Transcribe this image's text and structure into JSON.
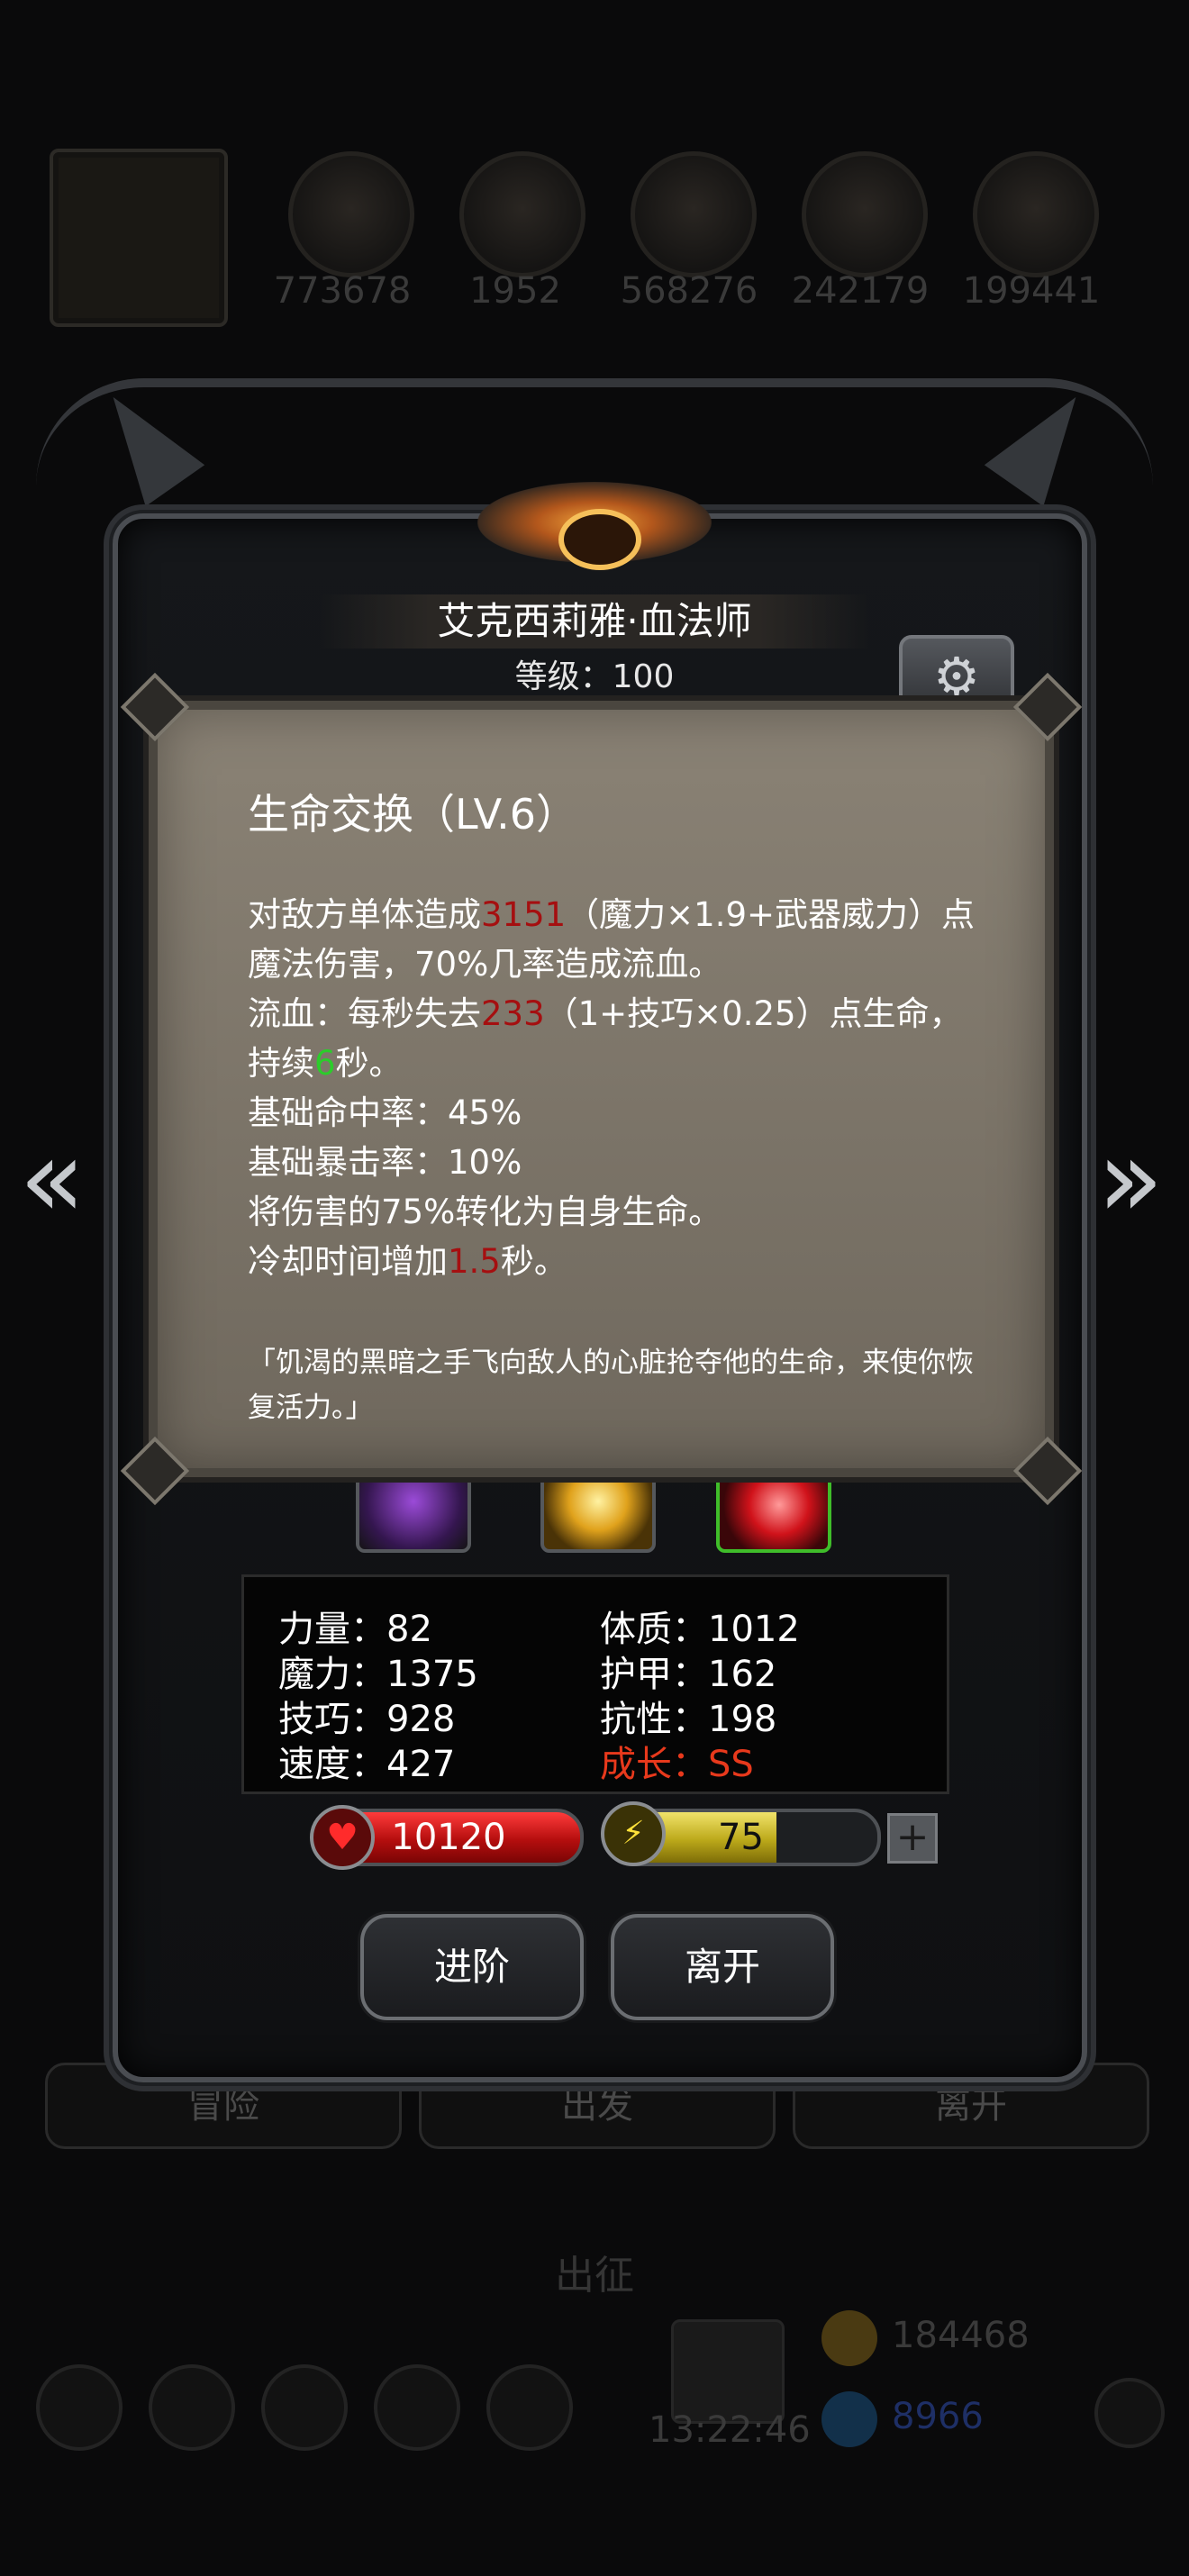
{
  "background": {
    "resources": [
      "773678",
      "1952",
      "568276",
      "242179",
      "199441"
    ],
    "tabs": [
      "冒险",
      "出发",
      "离开"
    ],
    "title": "出征",
    "time": "13:22:46",
    "gold": "184468",
    "gems": "8966"
  },
  "hero": {
    "name": "艾克西莉雅·血法师",
    "level": "等级：100"
  },
  "skill_tooltip": {
    "title": "生命交换（LV.6）",
    "desc": {
      "l1a": "对敌方单体造成",
      "l1_dmg": "3151",
      "l1b": "（魔力×1.9+武器威力）点魔法伤害，70%几率造成流血。",
      "l2a": "流血：每秒失去",
      "l2_val": "233",
      "l2b": "（1+技巧×0.25）点生命，持续",
      "l2_dur": "6",
      "l2c": "秒。",
      "l3": "基础命中率：45%",
      "l4": "基础暴击率：10%",
      "l5": "将伤害的75%转化为自身生命。",
      "l6a": "冷却时间增加",
      "l6_val": "1.5",
      "l6b": "秒。"
    },
    "flavor": "「饥渴的黑暗之手飞向敌人的心脏抢夺他的生命，来使你恢复活力。」"
  },
  "stats": {
    "strength": "力量：82",
    "constitution": "体质：1012",
    "magic": "魔力：1375",
    "armor": "护甲：162",
    "skill": "技巧：928",
    "resistance": "抗性：198",
    "speed": "速度：427",
    "growth": "成长：SS"
  },
  "bars": {
    "hp": "10120",
    "energy": "75",
    "energy_fill": 0.62
  },
  "buttons": {
    "advance": "进阶",
    "leave": "离开"
  },
  "colors": {
    "highlight_red": "#a50f10",
    "highlight_green": "#2bcc2b",
    "growth": "#e8391c"
  }
}
